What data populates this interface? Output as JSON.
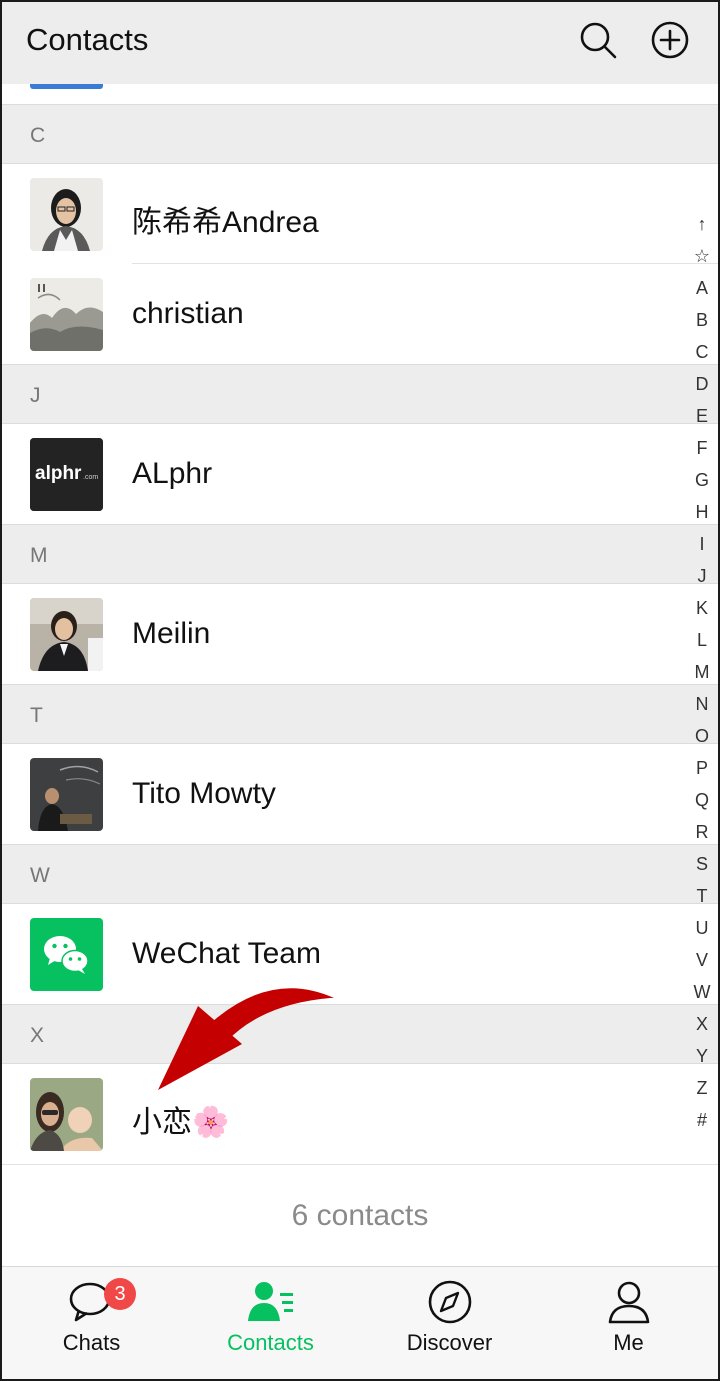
{
  "header": {
    "title": "Contacts"
  },
  "sections": [
    {
      "letter": "C",
      "contacts": [
        {
          "name": "陈希希Andrea"
        },
        {
          "name": "christian"
        }
      ]
    },
    {
      "letter": "J",
      "contacts": [
        {
          "name": "ALphr"
        }
      ]
    },
    {
      "letter": "M",
      "contacts": [
        {
          "name": "Meilin"
        }
      ]
    },
    {
      "letter": "T",
      "contacts": [
        {
          "name": "Tito Mowty"
        }
      ]
    },
    {
      "letter": "W",
      "contacts": [
        {
          "name": "WeChat Team"
        }
      ]
    },
    {
      "letter": "X",
      "contacts": [
        {
          "name": "小恋🌸"
        }
      ]
    }
  ],
  "alphr_logo_text": "alphr",
  "alphr_logo_suffix": ".com",
  "contact_count": "6 contacts",
  "index": [
    "↑",
    "☆",
    "A",
    "B",
    "C",
    "D",
    "E",
    "F",
    "G",
    "H",
    "I",
    "J",
    "K",
    "L",
    "M",
    "N",
    "O",
    "P",
    "Q",
    "R",
    "S",
    "T",
    "U",
    "V",
    "W",
    "X",
    "Y",
    "Z",
    "#"
  ],
  "tabs": [
    {
      "label": "Chats",
      "badge": "3"
    },
    {
      "label": "Contacts"
    },
    {
      "label": "Discover"
    },
    {
      "label": "Me"
    }
  ],
  "colors": {
    "accent": "#07c160",
    "badge": "#f04747",
    "arrow": "#c40000",
    "header_bg": "#ededed"
  }
}
